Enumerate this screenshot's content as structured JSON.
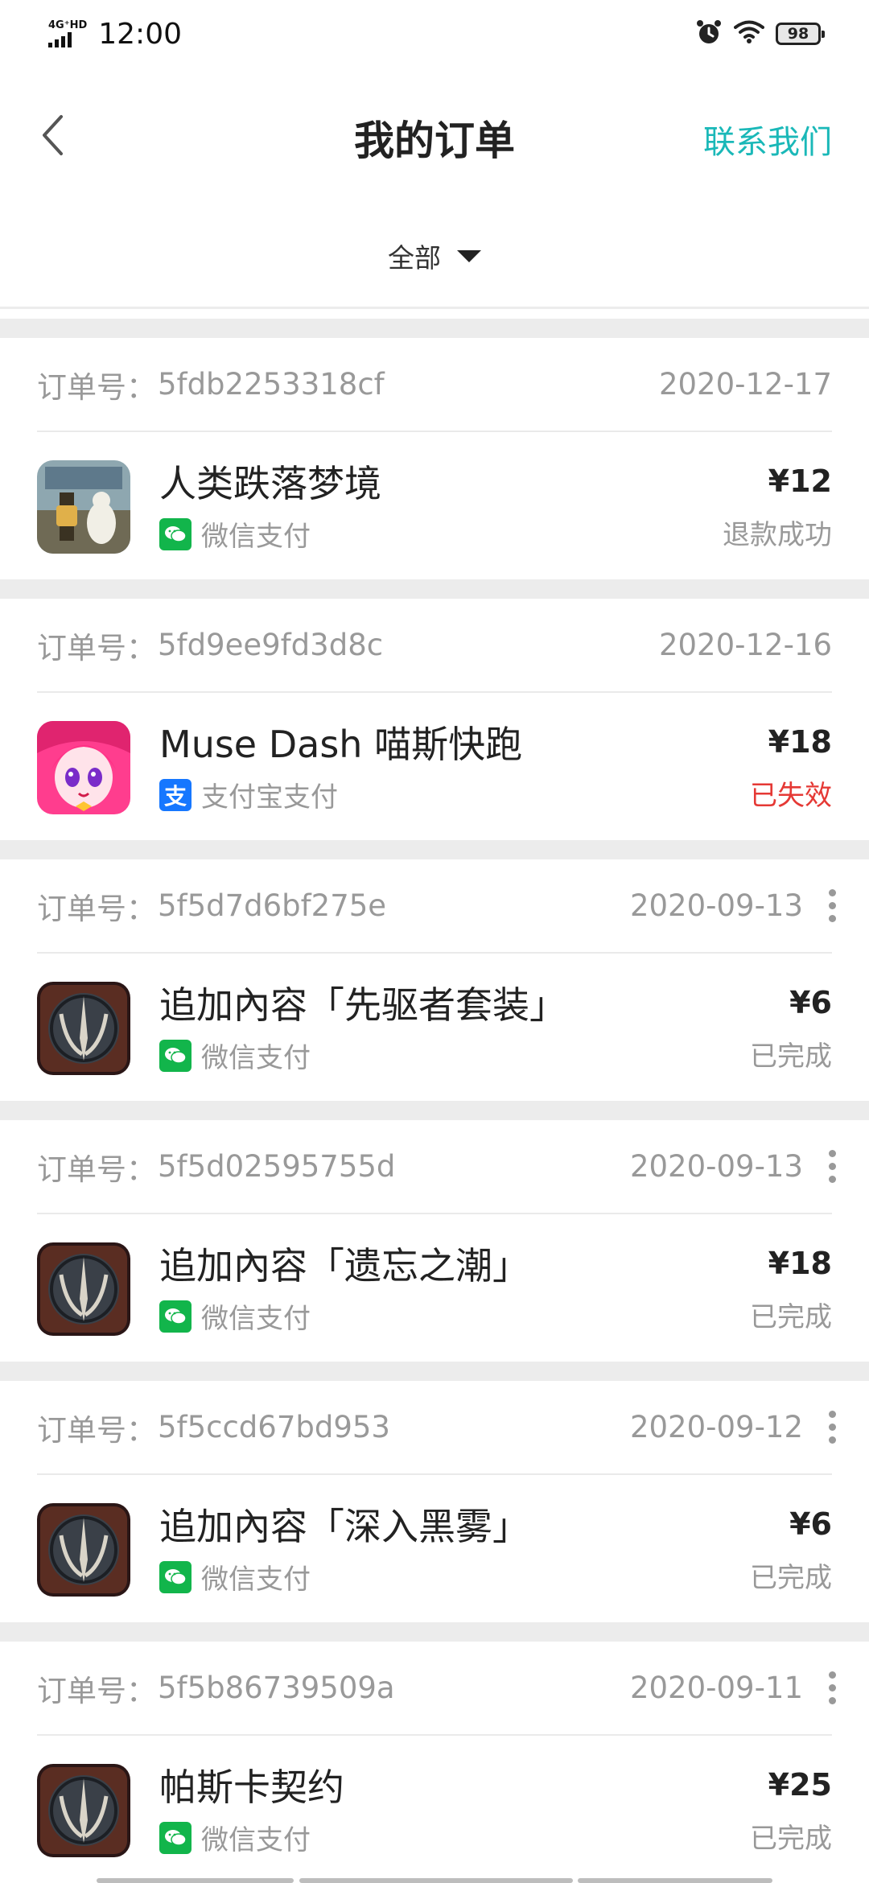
{
  "status_bar": {
    "network": "4G⁺HD",
    "time": "12:00",
    "battery": "98"
  },
  "header": {
    "title": "我的订单",
    "contact": "联系我们"
  },
  "filter": {
    "label": "全部"
  },
  "orders": [
    {
      "order_no_label": "订单号：",
      "order_no": "5fdb2253318cf",
      "date": "2020-12-17",
      "name": "人类跌落梦境",
      "payment": "微信支付",
      "price": "¥12",
      "status": "退款成功",
      "thumb": "human-fall-flat",
      "pay_type": "wechat",
      "has_more": false
    },
    {
      "order_no_label": "订单号：",
      "order_no": "5fd9ee9fd3d8c",
      "date": "2020-12-16",
      "name": "Muse Dash 喵斯快跑",
      "payment": "支付宝支付",
      "price": "¥18",
      "status": "已失效",
      "thumb": "muse-dash",
      "pay_type": "alipay",
      "has_more": false
    },
    {
      "order_no_label": "订单号：",
      "order_no": "5f5d7d6bf275e",
      "date": "2020-09-13",
      "name": "追加內容「先驱者套装」",
      "payment": "微信支付",
      "price": "¥6",
      "status": "已完成",
      "thumb": "dark-emblem",
      "pay_type": "wechat",
      "has_more": true
    },
    {
      "order_no_label": "订单号：",
      "order_no": "5f5d02595755d",
      "date": "2020-09-13",
      "name": "追加內容「遗忘之潮」",
      "payment": "微信支付",
      "price": "¥18",
      "status": "已完成",
      "thumb": "dark-emblem",
      "pay_type": "wechat",
      "has_more": true
    },
    {
      "order_no_label": "订单号：",
      "order_no": "5f5ccd67bd953",
      "date": "2020-09-12",
      "name": "追加內容「深入黑雾」",
      "payment": "微信支付",
      "price": "¥6",
      "status": "已完成",
      "thumb": "dark-emblem",
      "pay_type": "wechat",
      "has_more": true
    },
    {
      "order_no_label": "订单号：",
      "order_no": "5f5b86739509a",
      "date": "2020-09-11",
      "name": "帕斯卡契约",
      "payment": "微信支付",
      "price": "¥25",
      "status": "已完成",
      "thumb": "dark-emblem",
      "pay_type": "wechat",
      "has_more": true
    }
  ],
  "colors": {
    "accent": "#1ab8b8",
    "failed": "#e53935",
    "wechat": "#12b54b",
    "alipay": "#1677ff"
  }
}
